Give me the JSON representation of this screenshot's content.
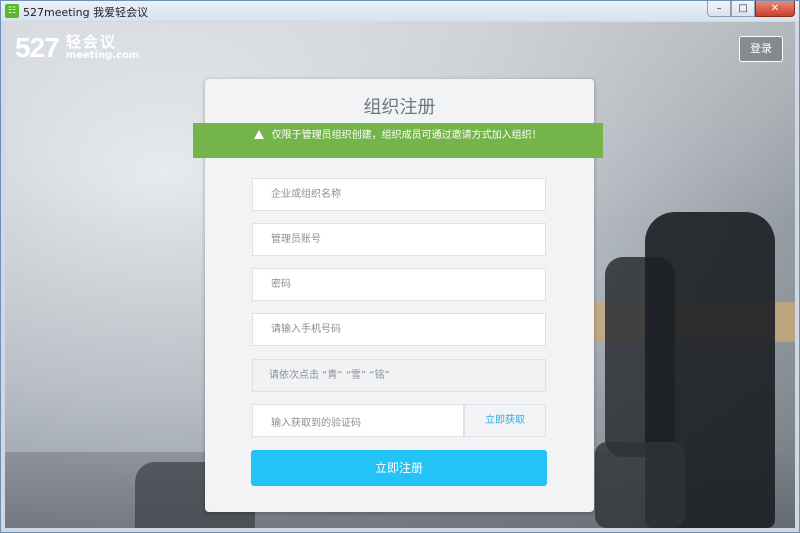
{
  "window": {
    "title": "527meeting 我爱轻会议",
    "app_icon_glyph": "☷",
    "buttons": {
      "minimize": "–",
      "maximize": "□",
      "close": "✕"
    }
  },
  "logo": {
    "number": "527",
    "name": "轻会议",
    "domain": "meeting.com"
  },
  "header": {
    "login_label": "登录"
  },
  "form": {
    "title": "组织注册",
    "notice": "仅限于管理员组织创建，组织成员可通过邀请方式加入组织！",
    "fields": {
      "org_name": {
        "placeholder": "企业或组织名称"
      },
      "admin_account": {
        "placeholder": "管理员账号"
      },
      "password": {
        "placeholder": "密码"
      },
      "phone": {
        "placeholder": "请输入手机号码"
      },
      "captcha_prompt": "请依次点击 “青” “雪” “铭”",
      "sms_code": {
        "placeholder": "输入获取到的验证码"
      }
    },
    "get_code_label": "立即获取",
    "submit_label": "立即注册"
  },
  "colors": {
    "banner": "#74b44a",
    "primary": "#22c3f6",
    "link": "#2ab0e8"
  }
}
